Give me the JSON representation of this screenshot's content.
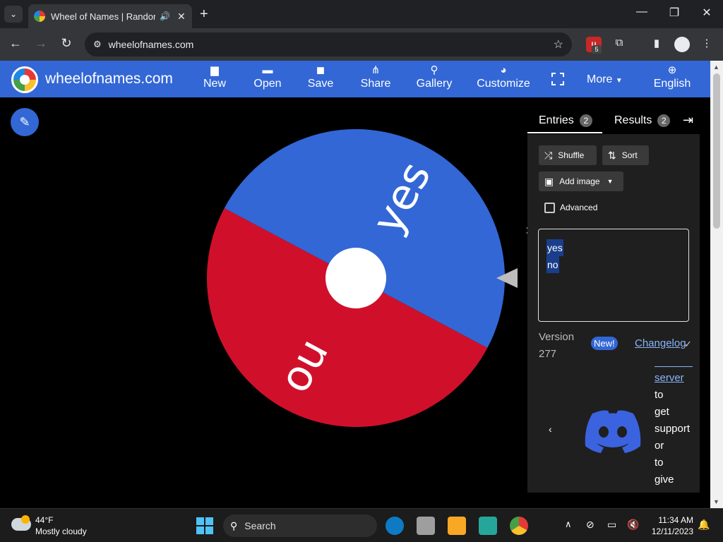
{
  "browser": {
    "tab_title": "Wheel of Names | Random",
    "url": "wheelofnames.com",
    "ext_badge": "5"
  },
  "app": {
    "site_name": "wheelofnames.com",
    "toolbar": {
      "new": "New",
      "open": "Open",
      "save": "Save",
      "share": "Share",
      "gallery": "Gallery",
      "customize": "Customize",
      "more": "More",
      "language": "English"
    },
    "wheel": {
      "segments": [
        {
          "label": "yes",
          "color": "#3367d6"
        },
        {
          "label": "no",
          "color": "#d0102b"
        }
      ]
    },
    "panel": {
      "tab_entries": "Entries",
      "tab_entries_count": "2",
      "tab_results": "Results",
      "tab_results_count": "2",
      "shuffle": "Shuffle",
      "sort": "Sort",
      "add_image": "Add image",
      "advanced": "Advanced",
      "entries": [
        "yes",
        "no"
      ],
      "version_label": "Version",
      "version_number": "277",
      "new_badge": "New!",
      "changelog": "Changelog",
      "promo_link": "server",
      "promo_words": [
        "to",
        "get",
        "support",
        "or",
        "to",
        "give"
      ]
    }
  },
  "taskbar": {
    "temperature": "44°F",
    "weather": "Mostly cloudy",
    "search": "Search",
    "time": "11:34 AM",
    "date": "12/11/2023"
  }
}
